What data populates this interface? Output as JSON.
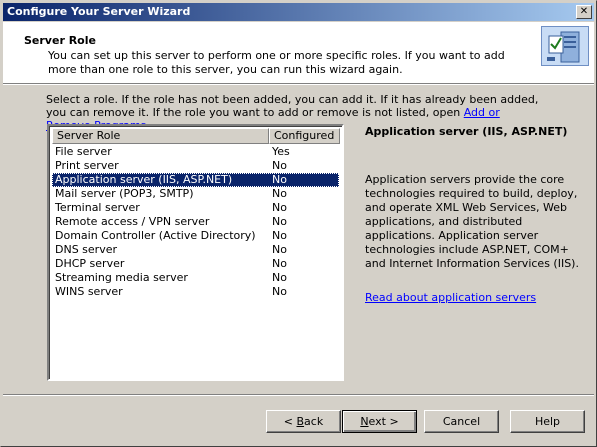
{
  "window": {
    "title": "Configure Your Server Wizard",
    "close_glyph": "✕"
  },
  "header": {
    "title": "Server Role",
    "description": "You can set up this server to perform one or more specific roles. If you want to add more than one role to this server, you can run this wizard again."
  },
  "instructions": {
    "text": "Select a role. If the role has not been added, you can add it. If it has already been added, you can remove it. If the role you want to add or remove is not listed, open ",
    "link": "Add or Remove Programs",
    "suffix": "."
  },
  "roles": {
    "columns": [
      "Server Role",
      "Configured"
    ],
    "rows": [
      {
        "role": "File server",
        "configured": "Yes"
      },
      {
        "role": "Print server",
        "configured": "No"
      },
      {
        "role": "Application server (IIS, ASP.NET)",
        "configured": "No"
      },
      {
        "role": "Mail server (POP3, SMTP)",
        "configured": "No"
      },
      {
        "role": "Terminal server",
        "configured": "No"
      },
      {
        "role": "Remote access / VPN server",
        "configured": "No"
      },
      {
        "role": "Domain Controller (Active Directory)",
        "configured": "No"
      },
      {
        "role": "DNS server",
        "configured": "No"
      },
      {
        "role": "DHCP server",
        "configured": "No"
      },
      {
        "role": "Streaming media server",
        "configured": "No"
      },
      {
        "role": "WINS server",
        "configured": "No"
      }
    ],
    "selected_index": 2
  },
  "detail": {
    "title": "Application server (IIS, ASP.NET)",
    "description": "Application servers provide the core technologies required to build, deploy, and operate XML Web Services, Web applications, and distributed applications. Application server technologies include ASP.NET, COM+ and Internet Information Services (IIS).",
    "link": "Read about application servers"
  },
  "buttons": {
    "back_prefix": "< ",
    "back_key": "B",
    "back_rest": "ack",
    "next_key": "N",
    "next_rest": "ext >",
    "cancel": "Cancel",
    "help": "Help"
  },
  "icons": {
    "header": "wizard-server-icon",
    "close": "close-icon"
  },
  "colors": {
    "title_start": "#0a246a",
    "title_end": "#a6caf0",
    "selection": "#0a246a",
    "link": "#0000ff"
  }
}
